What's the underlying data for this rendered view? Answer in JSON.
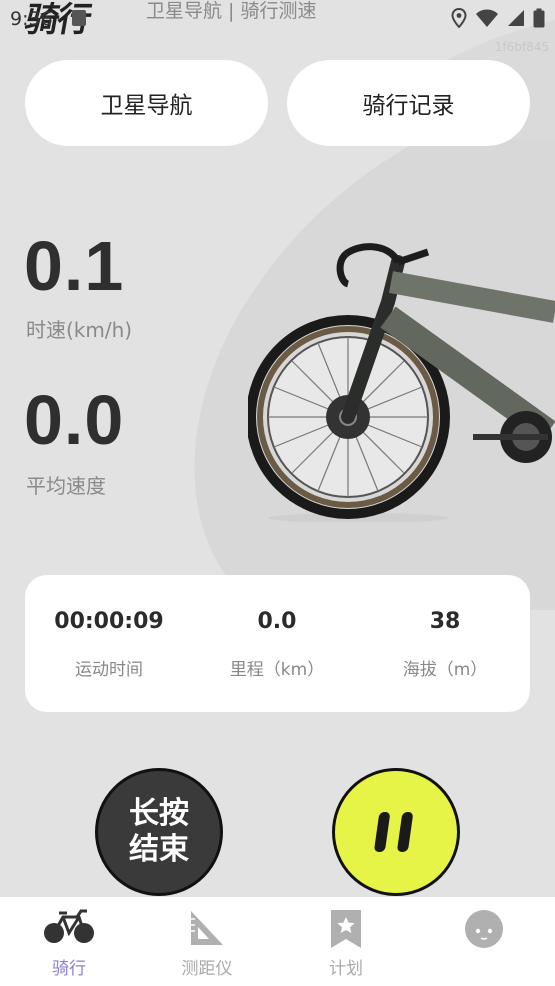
{
  "status_bar": {
    "time": "9:36"
  },
  "header": {
    "logo_text": "骑行",
    "title": "卫星导航 | 骑行测速",
    "build_id": "1f6bf845"
  },
  "buttons": {
    "navigation": "卫星导航",
    "ride_record": "骑行记录"
  },
  "speed": {
    "value": "0.1",
    "label": "时速(km/h)"
  },
  "avg_speed": {
    "value": "0.0",
    "label": "平均速度"
  },
  "stats": [
    {
      "value": "00:00:09",
      "label": "运动时间"
    },
    {
      "value": "0.0",
      "label": "里程（km）"
    },
    {
      "value": "38",
      "label": "海拔（m）"
    }
  ],
  "controls": {
    "end_line1": "长按",
    "end_line2": "结束",
    "pause_icon": "pause-icon"
  },
  "tabs": [
    {
      "label": "骑行",
      "icon": "bicycle-icon",
      "active": true
    },
    {
      "label": "测距仪",
      "icon": "ruler-icon",
      "active": false
    },
    {
      "label": "计划",
      "icon": "bookmark-star-icon",
      "active": false
    },
    {
      "label": "",
      "icon": "avatar-icon",
      "active": false
    }
  ],
  "colors": {
    "accent": "#e6f347",
    "active_tab": "#8b7fd0",
    "background": "#e2e2e2"
  }
}
